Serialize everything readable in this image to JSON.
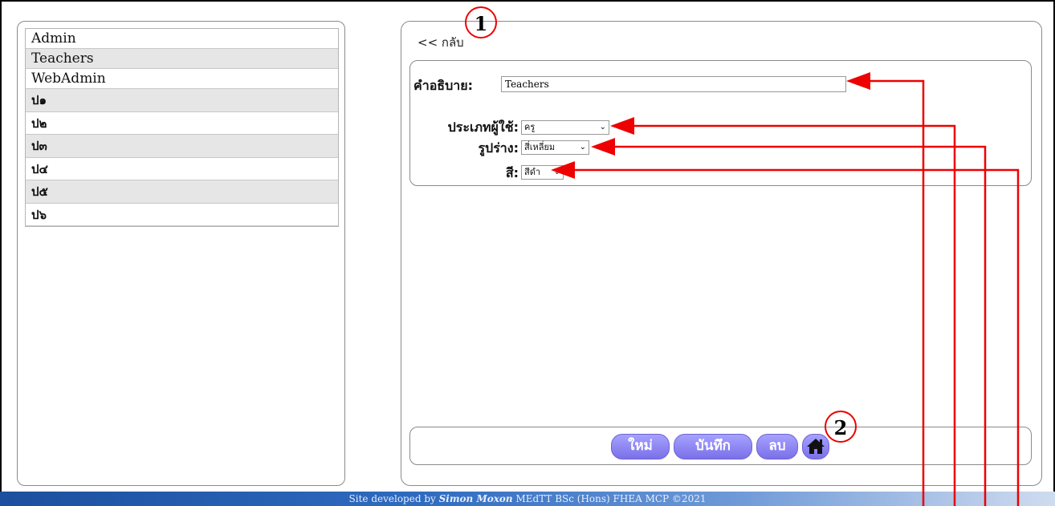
{
  "groups": [
    "Admin",
    "Teachers",
    "WebAdmin",
    "ป๑",
    "ป๒",
    "ป๓",
    "ป๔",
    "ป๕",
    "ป๖"
  ],
  "back_label": "<< กลับ",
  "form": {
    "description_label": "คำอธิบาย:",
    "description_value": "Teachers",
    "user_type_label": "ประเภทผู้ใช้:",
    "user_type_value": "ครู",
    "shape_label": "รูปร่าง:",
    "shape_value": "สี่เหลี่ยม",
    "color_label": "สี:",
    "color_value": "สีดำ"
  },
  "buttons": {
    "new_label": "ใหม่",
    "save_label": "บันทึก",
    "delete_label": "ลบ",
    "home_icon": "home-icon"
  },
  "footer": {
    "prefix": "Site developed by",
    "author": "Simon Moxon",
    "credentials": "MEdTT  BSc (Hons)  FHEA  MCP  ©2021"
  },
  "annotations": {
    "marker_1": "1",
    "marker_2": "2"
  },
  "colors": {
    "button": "#8a82f5",
    "annotation": "#ee0000",
    "footer": "#2e6bc0"
  }
}
